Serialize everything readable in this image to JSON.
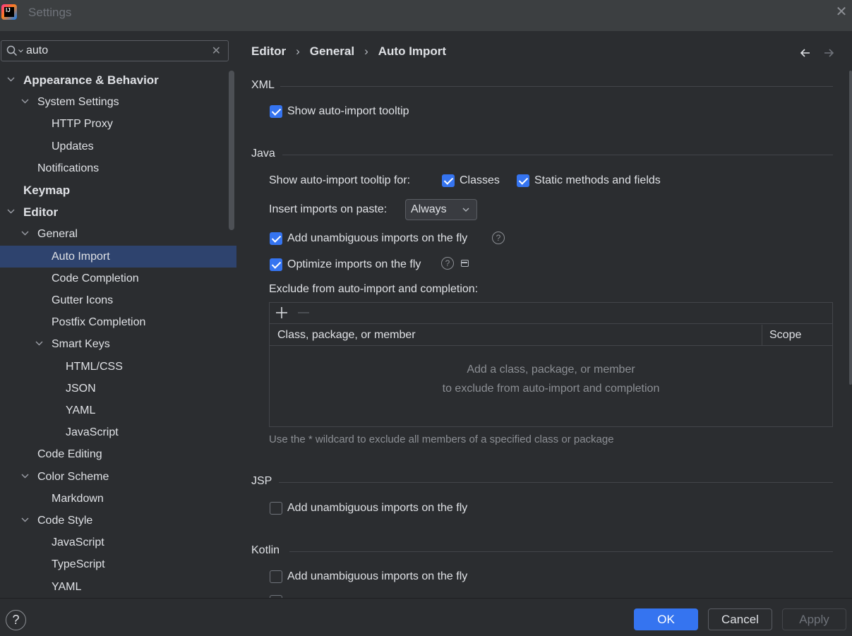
{
  "window": {
    "title": "Settings",
    "logo_text": "IJ"
  },
  "search": {
    "value": "auto"
  },
  "sidebar": {
    "items": [
      {
        "label": "Appearance & Behavior",
        "bold": true,
        "expanded": true,
        "level": 0
      },
      {
        "label": "System Settings",
        "bold": false,
        "expanded": true,
        "level": 1
      },
      {
        "label": "HTTP Proxy",
        "level": 2
      },
      {
        "label": "Updates",
        "level": 2
      },
      {
        "label": "Notifications",
        "level": 1
      },
      {
        "label": "Keymap",
        "bold": true,
        "level": 0
      },
      {
        "label": "Editor",
        "bold": true,
        "expanded": true,
        "level": 0
      },
      {
        "label": "General",
        "expanded": true,
        "level": 1
      },
      {
        "label": "Auto Import",
        "level": 2,
        "selected": true
      },
      {
        "label": "Code Completion",
        "level": 2
      },
      {
        "label": "Gutter Icons",
        "level": 2
      },
      {
        "label": "Postfix Completion",
        "level": 2
      },
      {
        "label": "Smart Keys",
        "expanded": true,
        "level": 2
      },
      {
        "label": "HTML/CSS",
        "level": 3
      },
      {
        "label": "JSON",
        "level": 3
      },
      {
        "label": "YAML",
        "level": 3
      },
      {
        "label": "JavaScript",
        "level": 3
      },
      {
        "label": "Code Editing",
        "level": 1
      },
      {
        "label": "Color Scheme",
        "expanded": true,
        "level": 1
      },
      {
        "label": "Markdown",
        "level": 2
      },
      {
        "label": "Code Style",
        "expanded": true,
        "level": 1
      },
      {
        "label": "JavaScript",
        "level": 2
      },
      {
        "label": "TypeScript",
        "level": 2
      },
      {
        "label": "YAML",
        "level": 2
      }
    ]
  },
  "breadcrumb": {
    "items": [
      "Editor",
      "General",
      "Auto Import"
    ],
    "separator": "›"
  },
  "xml": {
    "title": "XML",
    "show_tooltip": {
      "label": "Show auto-import tooltip",
      "checked": true
    }
  },
  "java": {
    "title": "Java",
    "tooltip_for_label": "Show auto-import tooltip for:",
    "classes": {
      "label": "Classes",
      "checked": true
    },
    "static": {
      "label": "Static methods and fields",
      "checked": true
    },
    "insert_on_paste_label": "Insert imports on paste:",
    "insert_on_paste_value": "Always",
    "add_unambiguous": {
      "label": "Add unambiguous imports on the fly",
      "checked": true
    },
    "optimize": {
      "label": "Optimize imports on the fly",
      "checked": true
    },
    "exclude_label": "Exclude from auto-import and completion:",
    "table": {
      "columns": [
        "Class, package, or member",
        "Scope"
      ],
      "empty_line1": "Add a class, package, or member",
      "empty_line2": "to exclude from auto-import and completion"
    },
    "hint": "Use the * wildcard to exclude all members of a specified class or package"
  },
  "jsp": {
    "title": "JSP",
    "add_unambiguous": {
      "label": "Add unambiguous imports on the fly",
      "checked": false
    }
  },
  "kotlin": {
    "title": "Kotlin",
    "add_unambiguous": {
      "label": "Add unambiguous imports on the fly",
      "checked": false
    }
  },
  "footer": {
    "ok": "OK",
    "cancel": "Cancel",
    "apply": "Apply",
    "help": "?"
  },
  "colors": {
    "accent": "#3574f0",
    "selection": "#2e436e",
    "background": "#2b2d30"
  }
}
